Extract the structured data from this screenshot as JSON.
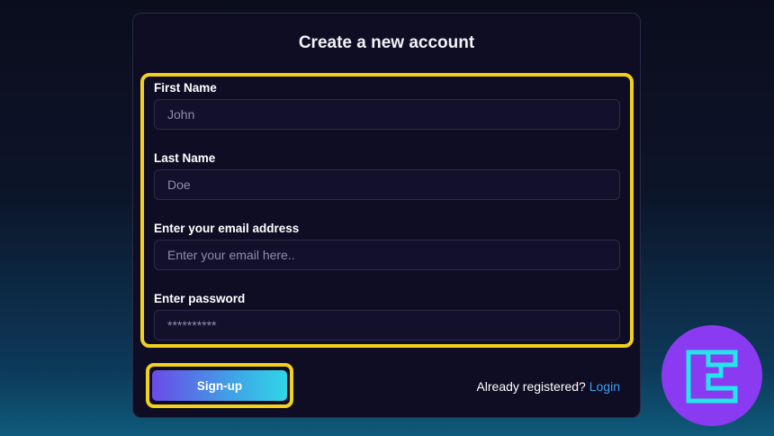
{
  "form": {
    "title": "Create a new account",
    "fields": [
      {
        "label": "First Name",
        "placeholder": "John"
      },
      {
        "label": "Last Name",
        "placeholder": "Doe"
      },
      {
        "label": "Enter your email address",
        "placeholder": "Enter your email here.."
      },
      {
        "label": "Enter password",
        "placeholder": "**********"
      }
    ],
    "signup_label": "Sign-up",
    "already_registered": "Already registered?",
    "login_label": "Login"
  },
  "colors": {
    "highlight": "#f2d01c",
    "card_bg": "#0f0d24",
    "link": "#3ea0f0",
    "badge": "#8a3af0",
    "logo_stroke": "#22e6ea"
  },
  "brand": {
    "logo_icon": "tradingfinder-logo-icon"
  }
}
